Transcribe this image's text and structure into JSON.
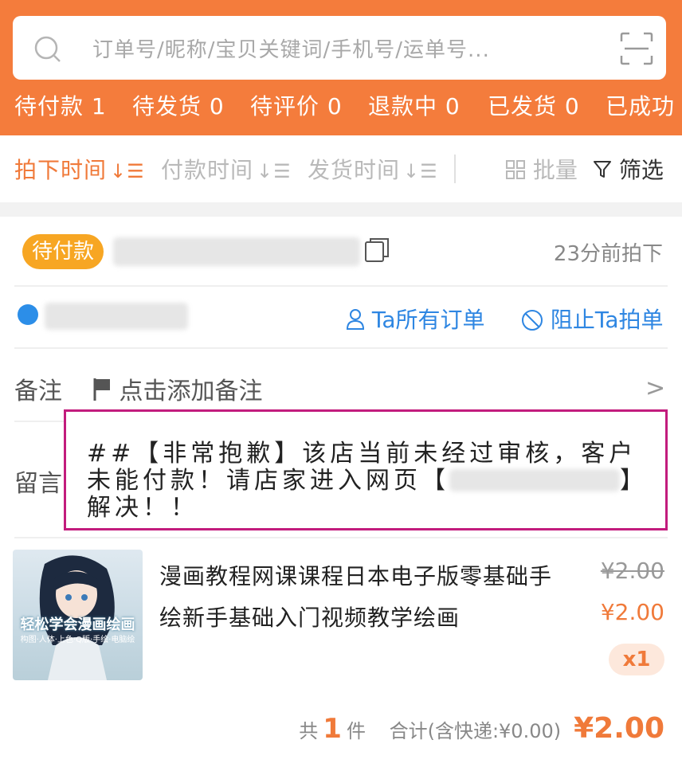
{
  "search": {
    "placeholder": "订单号/昵称/宝贝关键词/手机号/运单号..."
  },
  "status_tabs": [
    {
      "label": "待付款 1"
    },
    {
      "label": "待发货 0"
    },
    {
      "label": "待评价 0"
    },
    {
      "label": "退款中 0"
    },
    {
      "label": "已发货 0"
    },
    {
      "label": "已成功"
    }
  ],
  "sort": {
    "items": [
      {
        "label": "拍下时间",
        "glyph": "↓☰",
        "active": true
      },
      {
        "label": "付款时间",
        "glyph": "↓☰",
        "active": false
      },
      {
        "label": "发货时间",
        "glyph": "↓☰",
        "active": false
      }
    ],
    "batch_label": "批量",
    "filter_label": "筛选"
  },
  "order": {
    "status_badge": "待付款",
    "time_ago": "23分前拍下",
    "all_orders_link": "Ta所有订单",
    "block_link": "阻止Ta拍单",
    "note_label": "备注",
    "note_add": "点击添加备注",
    "message_label": "留言",
    "message_text": "##【非常抱歉】该店当前未经过审核，客户未能付款！请店家进入网页【",
    "message_text_end": "】解决！！",
    "item": {
      "thumb_title": "轻松学会漫画绘画",
      "thumb_sub": "构图·人体·上色·Q版·手绘·电脑绘",
      "title": "漫画教程网课课程日本电子版零基础手绘新手基础入门视频教学绘画",
      "original_price": "¥2.00",
      "price": "¥2.00",
      "quantity": "x1"
    },
    "summary": {
      "prefix": "共",
      "count": "1",
      "suffix": "件",
      "total_label": "合计(含快递:¥0.00)",
      "total": "¥2.00"
    }
  },
  "colors": {
    "brand": "#f47c3c",
    "accent_orange": "#f07a3a",
    "link_blue": "#2e86e2",
    "badge": "#f7a623",
    "annotation": "#c21c7d"
  }
}
